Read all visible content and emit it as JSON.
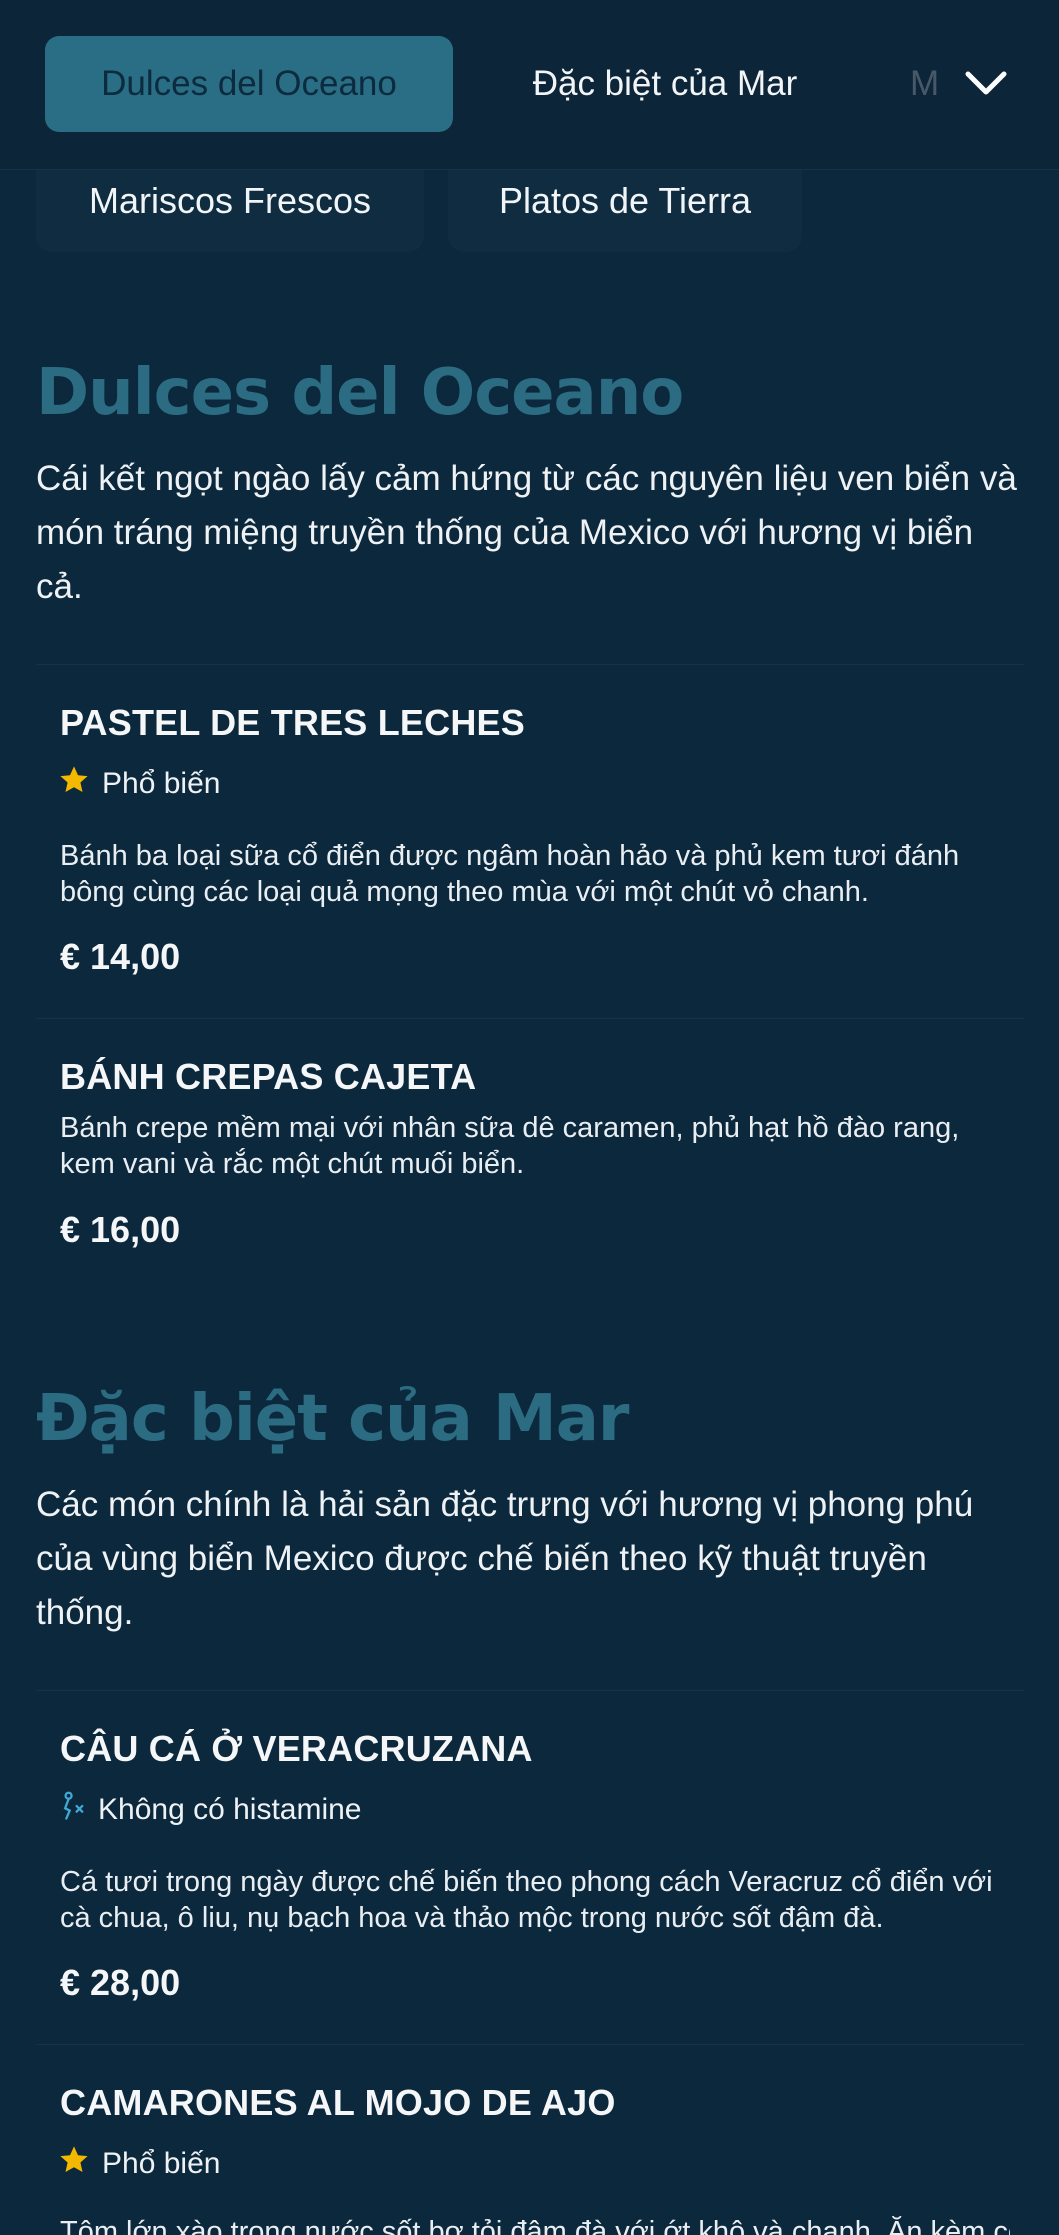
{
  "category_nav": {
    "tabs": [
      {
        "label": "Dulces del Oceano",
        "active": true
      },
      {
        "label": "Đặc biệt của Mar",
        "active": false
      },
      {
        "label": "M",
        "active": false
      }
    ],
    "second_row": [
      "Mariscos Frescos",
      "Platos de Tierra"
    ],
    "expand_icon": "chevron-down-icon"
  },
  "sections": [
    {
      "title": "Dulces del Oceano",
      "description": "Cái kết ngọt ngào lấy cảm hứng từ các nguyên liệu ven biển và món tráng miệng truyền thống của Mexico với hương vị biển cả.",
      "items": [
        {
          "name": "PASTEL DE TRES LECHES",
          "badge": {
            "icon": "star-icon",
            "label": "Phổ biến"
          },
          "description": "Bánh ba loại sữa cổ điển được ngâm hoàn hảo và phủ kem tươi đánh bông cùng các loại quả mọng theo mùa với một chút vỏ chanh.",
          "price": "€ 14,00"
        },
        {
          "name": "BÁNH CREPAS CAJETA",
          "description": "Bánh crepe mềm mại với nhân sữa dê caramen, phủ hạt hồ đào rang, kem vani và rắc một chút muối biển.",
          "price": "€ 16,00"
        }
      ]
    },
    {
      "title": "Đặc biệt của Mar",
      "description": "Các món chính là hải sản đặc trưng với hương vị phong phú của vùng biển Mexico được chế biến theo kỹ thuật truyền thống.",
      "items": [
        {
          "name": "CÂU CÁ Ở VERACRUZANA",
          "badge": {
            "icon": "histamine-free-icon",
            "label": "Không có histamine"
          },
          "description": "Cá tươi trong ngày được chế biến theo phong cách Veracruz cổ điển với cà chua, ô liu, nụ bạch hoa và thảo mộc trong nước sốt đậm đà.",
          "price": "€ 28,00"
        },
        {
          "name": "CAMARONES AL MOJO DE AJO",
          "badge": {
            "icon": "star-icon",
            "label": "Phổ biến"
          },
          "description": "Tôm lớn xào trong nước sốt bơ tỏi đậm đà với ớt khô và chanh. Ăn kèm cơm.",
          "price": ""
        }
      ]
    }
  ],
  "colors": {
    "background": "#0c283c",
    "header": "#0d2538",
    "accent": "#2a6e85",
    "section_title": "#2c6c83",
    "star": "#f5b800",
    "histamine_icon": "#3fa9d8"
  }
}
